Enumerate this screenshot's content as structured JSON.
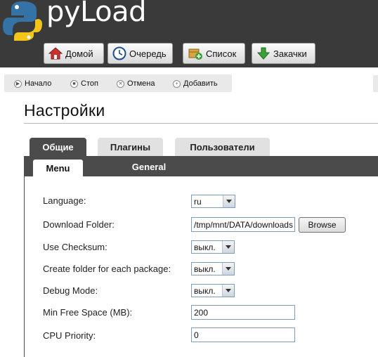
{
  "app": {
    "brand": "pyLoad"
  },
  "nav": {
    "home": "Домой",
    "queue": "Очередь",
    "list": "Список",
    "downloads": "Закачки"
  },
  "actions": {
    "start": "Начало",
    "stop": "Стоп",
    "cancel": "Отмена",
    "add": "Добавить"
  },
  "page": {
    "title": "Настройки"
  },
  "tabs": {
    "general": "Общие",
    "plugins": "Плагины",
    "users": "Пользователи"
  },
  "subtabs": {
    "menu": "Menu",
    "general": "General"
  },
  "form": {
    "language": {
      "label": "Language:",
      "value": "ru"
    },
    "download_folder": {
      "label": "Download Folder:",
      "value": "/tmp/mnt/DATA/downloads",
      "button": "Browse"
    },
    "use_checksum": {
      "label": "Use Checksum:",
      "value": "выкл."
    },
    "create_folder": {
      "label": "Create folder for each package:",
      "value": "выкл."
    },
    "debug_mode": {
      "label": "Debug Mode:",
      "value": "выкл."
    },
    "min_free_space": {
      "label": "Min Free Space (MB):",
      "value": "200"
    },
    "cpu_priority": {
      "label": "CPU Priority:",
      "value": "0"
    }
  },
  "icons": {
    "logo": "python-snake-logo",
    "home": "house-icon",
    "queue": "clock-icon",
    "list": "package-add-icon",
    "downloads": "down-arrow-icon"
  },
  "colors": {
    "header_bg": "#3a3a3a",
    "tab_dark": "#4b4b4b",
    "snake_blue": "#3572a5",
    "snake_yellow": "#f3c51a"
  }
}
